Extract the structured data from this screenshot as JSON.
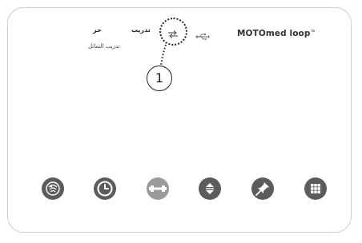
{
  "header": {
    "brand": "MOTOmed loop",
    "brand_suffix": "la",
    "mode_title_1": "تدريب",
    "mode_title_2": "حر",
    "mode_subtitle": "تدريب التماثل"
  },
  "status_icons": [
    "arrows-icon",
    "usb-icon"
  ],
  "callout": {
    "number": "1"
  },
  "toolbar": {
    "buttons": [
      {
        "icon": "therapist-icon"
      },
      {
        "icon": "clock-icon"
      },
      {
        "icon": "dumbbell-icon",
        "disabled": true
      },
      {
        "icon": "up-down-icon"
      },
      {
        "icon": "pin-icon"
      },
      {
        "icon": "grid-icon"
      }
    ]
  }
}
